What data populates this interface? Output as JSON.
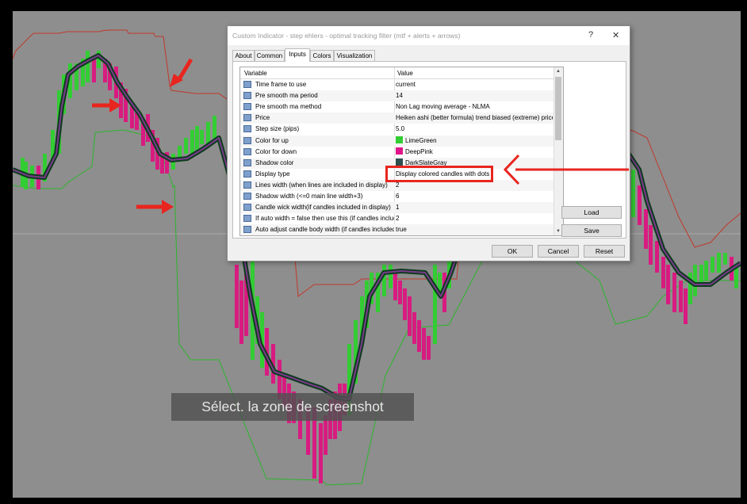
{
  "colors": {
    "chart_bg": "#8e8e8e",
    "up": "#32cd32",
    "down": "#d81b80",
    "shadow": "#2f4f4f",
    "band_upper": "#c0392b",
    "band_lower": "#2db52d",
    "line_outer": "#0d3b1e",
    "line_inner": "#7a3a8a",
    "annotation_red": "#e8251f"
  },
  "dialog": {
    "title": "Custom Indicator - step ehlers - optimal tracking filter (mtf + alerts + arrows)",
    "help_btn": "?",
    "close_btn": "✕",
    "tabs": [
      "About",
      "Common",
      "Inputs",
      "Colors",
      "Visualization"
    ],
    "active_tab": "Inputs",
    "grid": {
      "col_variable": "Variable",
      "col_value": "Value",
      "rows": [
        {
          "variable": "Time frame to use",
          "value": "current"
        },
        {
          "variable": "Pre smooth ma period",
          "value": "14"
        },
        {
          "variable": "Pre smooth ma method",
          "value": "Non Lag moving average - NLMA"
        },
        {
          "variable": "Price",
          "value": "Heiken ashi (better formula) trend biased (extreme) price"
        },
        {
          "variable": "Step size (pips)",
          "value": "5.0"
        },
        {
          "variable": "Color for up",
          "value": "LimeGreen",
          "swatch": "#32cd32"
        },
        {
          "variable": "Color for down",
          "value": "DeepPink",
          "swatch": "#e0148a"
        },
        {
          "variable": "Shadow color",
          "value": "DarkSlateGray",
          "swatch": "#2f4f4f"
        },
        {
          "variable": "Display type",
          "value": "Display colored candles with dots"
        },
        {
          "variable": "Lines width (when lines are included in display)",
          "value": "2"
        },
        {
          "variable": "Shadow width (<=0 main line width+3)",
          "value": "6"
        },
        {
          "variable": "Candle wick width(if candles included in display)",
          "value": "1"
        },
        {
          "variable": "If auto width = false then use this (if candles included ...",
          "value": "2"
        },
        {
          "variable": "Auto adjust candle body width (if candles included ...",
          "value": "true"
        }
      ]
    },
    "load_btn": "Load",
    "save_btn": "Save",
    "ok_btn": "OK",
    "cancel_btn": "Cancel",
    "reset_btn": "Reset"
  },
  "toast": "Sélect. la zone de screenshot"
}
